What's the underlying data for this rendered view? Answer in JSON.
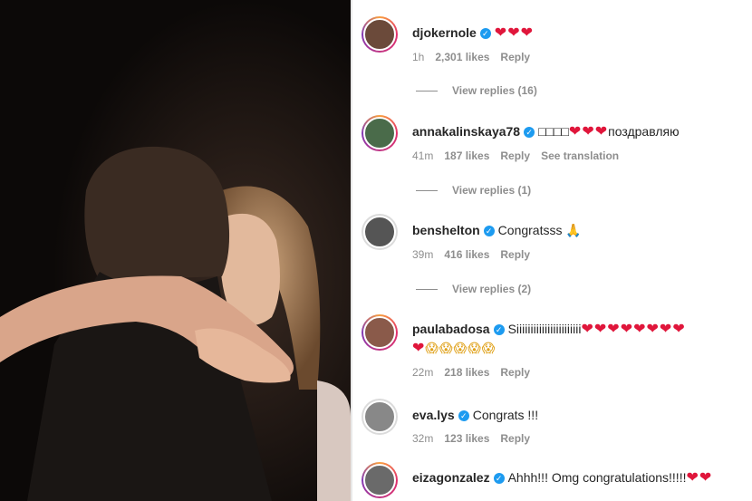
{
  "comments": [
    {
      "username": "djokernole",
      "text": "",
      "hearts": "❤❤❤",
      "time": "1h",
      "likes": "2,301 likes",
      "reply": "Reply",
      "view_replies": "View replies (16)",
      "avatar_color": "#6b4a3a"
    },
    {
      "username": "annakalinskaya78",
      "text": "□□□□",
      "hearts": "❤❤❤",
      "text_after": "поздравляю",
      "time": "41m",
      "likes": "187 likes",
      "reply": "Reply",
      "translation": "See translation",
      "view_replies": "View replies (1)",
      "avatar_color": "#4a6b4a"
    },
    {
      "username": "benshelton",
      "text": "Congratsss",
      "emoji": "🙏",
      "time": "39m",
      "likes": "416 likes",
      "reply": "Reply",
      "view_replies": "View replies (2)",
      "avatar_color": "#555555"
    },
    {
      "username": "paulabadosa",
      "text": "Siiiiiiiiiiiiiiiiiiiiiii",
      "hearts": "❤❤❤❤❤❤❤❤",
      "line2_hearts": "❤",
      "line2_emoji": "😱😱😱😱😱",
      "time": "22m",
      "likes": "218 likes",
      "reply": "Reply",
      "avatar_color": "#8a5a4a"
    },
    {
      "username": "eva.lys",
      "text": "Congrats !!!",
      "time": "32m",
      "likes": "123 likes",
      "reply": "Reply",
      "avatar_color": "#888888"
    },
    {
      "username": "eizagonzalez",
      "text": "Ahhh!!! Omg congratulations!!!!!",
      "hearts": "❤❤",
      "avatar_color": "#6a6a6a"
    }
  ],
  "colors": {
    "heart": "#e0163b",
    "verified": "#1d9bf0",
    "meta": "#8e8e8e",
    "text": "#262626"
  }
}
